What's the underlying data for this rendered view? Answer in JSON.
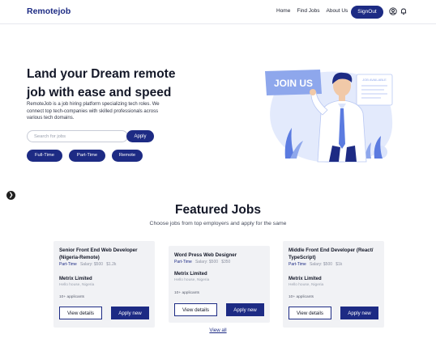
{
  "nav": {
    "brand": "Remotejob",
    "links": [
      "Home",
      "Find Jobs",
      "About Us"
    ],
    "signout_label": "SignOut",
    "icons": [
      "user-circle-icon",
      "bell-icon"
    ]
  },
  "hero": {
    "title": "Land your Dream remote job with ease and speed",
    "description": "RemoteJob is a job hiring platform specializing tech roles. We connect top tech-companies with skilled professionals across various tech domains.",
    "search_placeholder": "Search for jobs",
    "search_button": "Apply",
    "chips": [
      "Full-Time",
      "Part-Time",
      "Remote"
    ],
    "illustration": {
      "sign_text": "JOIN US",
      "board_text": "JOB AVAILABLE",
      "colors": {
        "light": "#dbe4fb",
        "mid": "#8ea7ec",
        "dark": "#1d2b84",
        "accent": "#5b7be0"
      }
    }
  },
  "featured": {
    "title": "Featured Jobs",
    "subtitle": "Choose jobs from top employers and apply for the same",
    "jobs": [
      {
        "title": "Senior Front End Web Developer (Nigeria-Remote)",
        "type": "Part-Time",
        "salary": "Salary: $500",
        "extra": "$1.2k",
        "company": "Metrix Limited",
        "location": "Hello house, Nigeria",
        "applicants": "10+ applicants",
        "view_label": "View details",
        "apply_label": "Apply new"
      },
      {
        "title": "Word Press Web Designer",
        "type": "Part-Time",
        "salary": "Salary: $500",
        "extra": "$350",
        "company": "Metrix Limited",
        "location": "Hello house, Nigeria",
        "applicants": "10+ applicants",
        "view_label": "View details",
        "apply_label": "Apply new"
      },
      {
        "title": "Middle Front End Developer (React/ TypeScript)",
        "type": "Part-Time",
        "salary": "Salary: $500",
        "extra": "$1k",
        "company": "Metrix Limited",
        "location": "Hello house, Nigeria",
        "applicants": "10+ applicants",
        "view_label": "View details",
        "apply_label": "Apply new"
      }
    ],
    "view_all": "View all"
  },
  "colors": {
    "primary": "#1d2b84",
    "card_bg": "#f1f2f5"
  }
}
